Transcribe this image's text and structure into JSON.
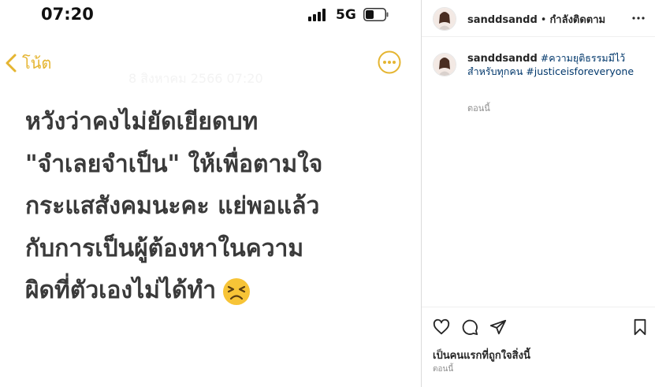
{
  "status_bar": {
    "time": "07:20",
    "network": "5G"
  },
  "notes": {
    "back_label": "โน้ต",
    "faint_date": "8 สิงหาคม 2566 07:20",
    "lines": [
      "หวังว่าคงไม่ยัดเยียดบท",
      "\"จำเลยจำเป็น\" ให้เพื่อตามใจ",
      "กระแสสังคมนะคะ แย่พอแล้ว",
      "กับการเป็นผู้ต้องหาในความ",
      "ผิดที่ตัวเองไม่ได้ทำ"
    ],
    "emoji": "😣"
  },
  "post": {
    "username": "sanddsandd",
    "follow_status": "กำลังติดตาม",
    "caption_user": "sanddsandd",
    "hashtags": [
      "#ความยุติธรรมมีไว้สำหรับทุกคน",
      "#justiceisforeveryone"
    ],
    "caption_time": "ตอนนี้",
    "likes_text": "เป็นคนแรกที่ถูกใจสิ่งนี้",
    "post_time": "ตอนนี้"
  },
  "colors": {
    "accent": "#e5b531",
    "link": "#00376b",
    "muted": "#8e8e8e"
  },
  "icons": [
    "back-chevron-icon",
    "more-circle-icon",
    "heart-icon",
    "comment-icon",
    "share-icon",
    "bookmark-icon",
    "more-horizontal-icon"
  ]
}
